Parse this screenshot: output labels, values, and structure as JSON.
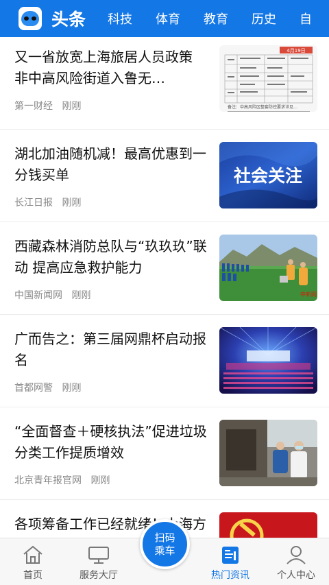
{
  "header": {
    "tabs": [
      {
        "label": "头条",
        "active": true
      },
      {
        "label": "科技"
      },
      {
        "label": "体育"
      },
      {
        "label": "教育"
      },
      {
        "label": "历史"
      },
      {
        "label": "自"
      }
    ]
  },
  "feed": {
    "items": [
      {
        "title": "又一省放宽上海旅居人员政策 非中高风险街道入鲁无…",
        "source": "第一财经",
        "time": "刚刚",
        "thumb_text": {
          "date": "4月19日",
          "caption": "备注：中高风险区整套防控要求详见…"
        }
      },
      {
        "title": "湖北加油随机减！最高优惠到一分钱买单",
        "source": "长江日报",
        "time": "刚刚",
        "thumb_text": {
          "banner": "社会关注"
        }
      },
      {
        "title": "西藏森林消防总队与“玖玖玖”联动 提高应急救护能力",
        "source": "中国新闻网",
        "time": "刚刚",
        "thumb_text": {
          "watermark": "中新网"
        }
      },
      {
        "title": "广而告之：第三届网鼎杯启动报名",
        "source": "首都网警",
        "time": "刚刚"
      },
      {
        "title": "“全面督查＋硬核执法”促进垃圾分类工作提质增效",
        "source": "北京青年报官网",
        "time": "刚刚"
      },
      {
        "title": "各项筹备工作已经就绪！上海方舱中心将举行…"
      }
    ]
  },
  "bottom_nav": {
    "items": [
      {
        "label": "首页",
        "icon": "home-icon"
      },
      {
        "label": "服务大厅",
        "icon": "monitor-icon"
      },
      {
        "label": "热门资讯",
        "icon": "news-icon",
        "active": true
      },
      {
        "label": "个人中心",
        "icon": "user-icon"
      }
    ],
    "scan": {
      "line1": "扫码",
      "line2": "乘车"
    }
  },
  "colors": {
    "brand": "#1477e6",
    "meta": "#888888",
    "inactive_nav": "#555555"
  }
}
